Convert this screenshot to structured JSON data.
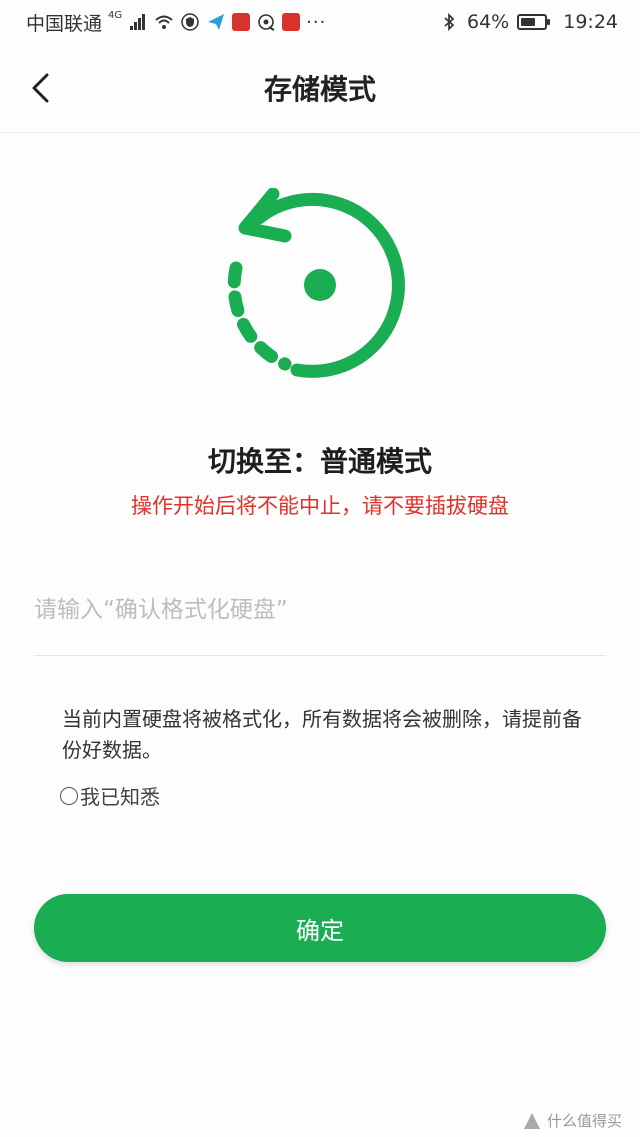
{
  "status_bar": {
    "carrier": "中国联通",
    "network": "4G",
    "battery_percent": "64%",
    "battery_level": 0.64,
    "time": "19:24",
    "more": "···",
    "icons": [
      "signal-icon",
      "wifi-icon",
      "vpn-shield-icon",
      "send-icon",
      "app-notification-icon",
      "hotspot-icon",
      "gallery-icon",
      "bluetooth-icon",
      "battery-icon"
    ]
  },
  "nav": {
    "title": "存储模式",
    "back_icon": "chevron-left-icon"
  },
  "hero_icon": "rotate-reset-icon",
  "switch": {
    "title": "切换至：普通模式",
    "warning": "操作开始后将不能中止，请不要插拔硬盘"
  },
  "input": {
    "value": "",
    "placeholder": "请输入“确认格式化硬盘”"
  },
  "notice": "当前内置硬盘将被格式化，所有数据将会被删除，请提前备份好数据。",
  "acknowledge": {
    "label": "我已知悉",
    "checked": false
  },
  "confirm_button": "确定",
  "watermark": "什么值得买",
  "colors": {
    "accent": "#1aad52",
    "warning": "#e0312b"
  }
}
